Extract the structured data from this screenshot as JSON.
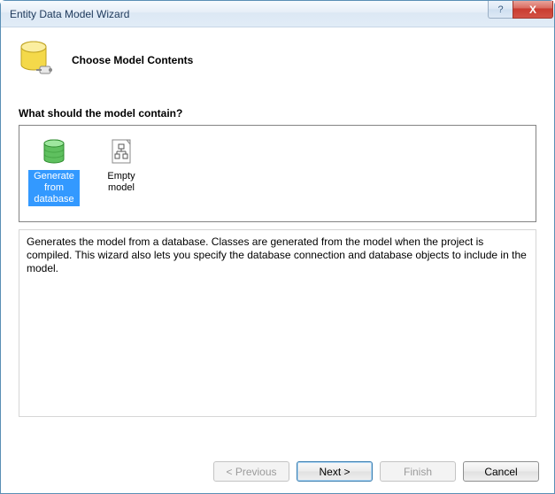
{
  "window": {
    "title": "Entity Data Model Wizard",
    "help_hint": "?",
    "close_hint": "X"
  },
  "header": {
    "title": "Choose Model Contents"
  },
  "section": {
    "prompt": "What should the model contain?"
  },
  "options": {
    "generate": {
      "label": "Generate from database"
    },
    "empty": {
      "label": "Empty model"
    }
  },
  "description": {
    "text": "Generates the model from a database. Classes are generated from the model when the project is compiled. This wizard also lets you specify the database connection and database objects to include in the model."
  },
  "buttons": {
    "previous": "< Previous",
    "next": "Next >",
    "finish": "Finish",
    "cancel": "Cancel"
  }
}
